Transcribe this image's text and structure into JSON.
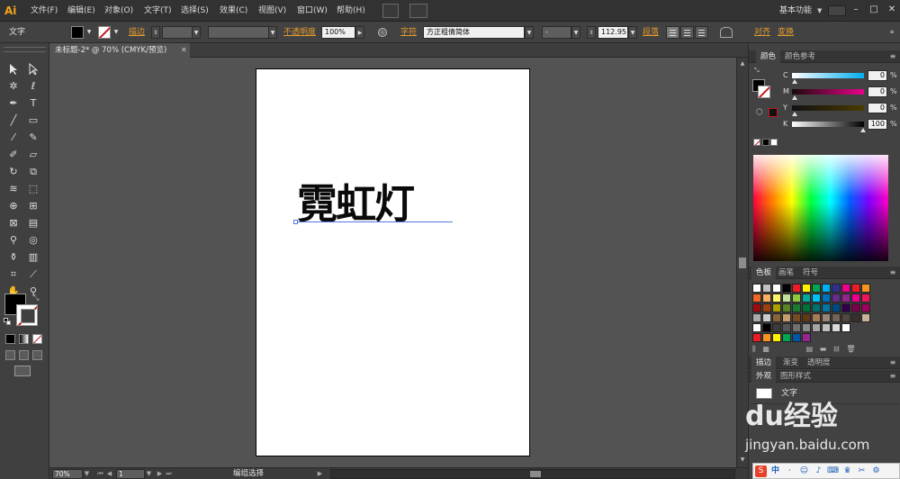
{
  "app": {
    "logo": "Ai",
    "menus": [
      "文件(F)",
      "编辑(E)",
      "对象(O)",
      "文字(T)",
      "选择(S)",
      "效果(C)",
      "视图(V)",
      "窗口(W)",
      "帮助(H)"
    ],
    "workspace": "基本功能",
    "window_buttons": [
      "–",
      "□",
      "✕"
    ]
  },
  "control_bar": {
    "selection_label": "文字",
    "stroke_label": "描边",
    "opacity_label": "不透明度",
    "opacity_value": "100%",
    "char_label": "字符",
    "font_family": "方正粗倩简体",
    "font_style": "-",
    "font_size": "112.95",
    "paragraph_label": "段落",
    "align_label": "对齐",
    "transform_label": "变换"
  },
  "document": {
    "tab_title": "未标题-2* @ 70% (CMYK/预览)",
    "art_text": "霓虹灯"
  },
  "status_bar": {
    "zoom": "70%",
    "artboard": "1",
    "status": "编组选择"
  },
  "panels": {
    "color_tabs": [
      "颜色",
      "颜色参考"
    ],
    "cmyk": [
      {
        "channel": "C",
        "value": "0",
        "color": "#00aeef",
        "pct": "%"
      },
      {
        "channel": "M",
        "value": "0",
        "color": "#ec008c",
        "pct": "%"
      },
      {
        "channel": "Y",
        "value": "0",
        "color": "#fff200",
        "pct": "%"
      },
      {
        "channel": "K",
        "value": "100",
        "color": "#000000",
        "pct": "%"
      }
    ],
    "swatch_tabs": [
      "色板",
      "画笔",
      "符号"
    ],
    "stroke_tabs": [
      "描边",
      "渐变",
      "透明度"
    ],
    "appearance_tabs": [
      "外观",
      "图形样式"
    ],
    "appearance_items": [
      "文字"
    ]
  },
  "watermark": {
    "logo": "du经验",
    "url": "jingyan.baidu.com"
  },
  "ime": {
    "items": [
      "S",
      "中",
      "·",
      "☺",
      "♪",
      "⌨",
      "♛",
      "✂",
      "⚙"
    ]
  },
  "colors": {
    "accent": "#f7a21b",
    "orange_label": "#e39a2f",
    "selection_blue": "#4f7be0",
    "chrome_dark": "#323232",
    "panel_bg": "#424242",
    "canvas_bg": "#535353"
  }
}
